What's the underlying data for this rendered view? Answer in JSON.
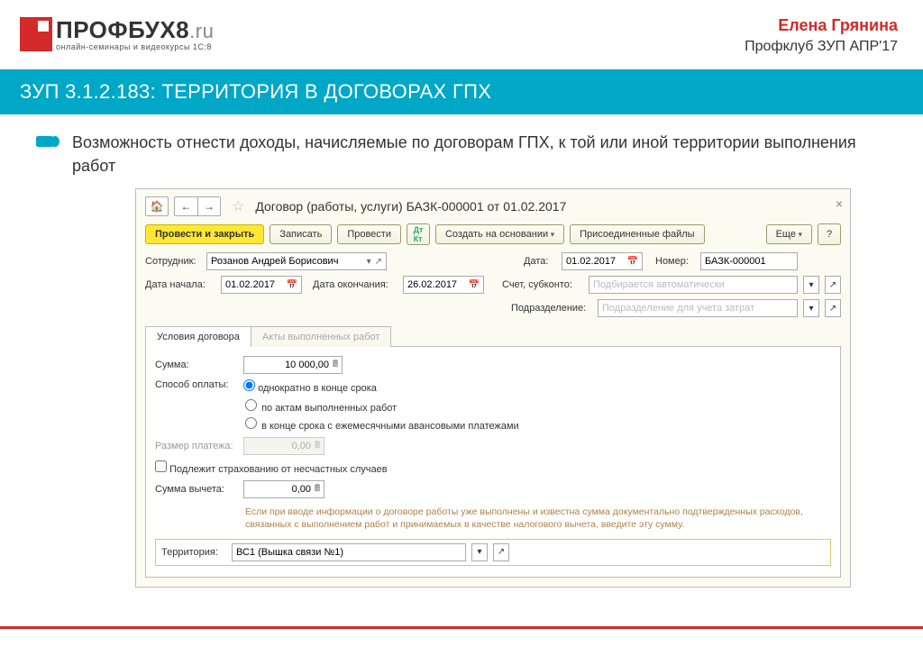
{
  "brand": {
    "main": "ПРОФБУХ8",
    "suffix": ".ru",
    "tagline": "онлайн-семинары и видеокурсы 1С:8"
  },
  "headerRight": {
    "name": "Елена Грянина",
    "sub": "Профклуб ЗУП АПР'17"
  },
  "slideTitle": "ЗУП 3.1.2.183: ТЕРРИТОРИЯ В ДОГОВОРАХ ГПХ",
  "bullet": "Возможность отнести доходы, начисляемые по договорам ГПХ, к той или иной территории выполнения работ",
  "win": {
    "title": "Договор (работы, услуги) БАЗК-000001 от 01.02.2017",
    "btn_primary": "Провести и закрыть",
    "btn_save": "Записать",
    "btn_post": "Провести",
    "btn_createBy": "Создать на основании",
    "btn_files": "Присоединенные файлы",
    "btn_more": "Еще",
    "lbl_employee": "Сотрудник:",
    "val_employee": "Розанов Андрей Борисович",
    "lbl_date": "Дата:",
    "val_date": "01.02.2017",
    "lbl_number": "Номер:",
    "val_number": "БАЗК-000001",
    "lbl_dateStart": "Дата начала:",
    "val_dateStart": "01.02.2017",
    "lbl_dateEnd": "Дата окончания:",
    "val_dateEnd": "26.02.2017",
    "lbl_account": "Счет, субконто:",
    "ph_account": "Подбирается автоматически",
    "lbl_dept": "Подразделение:",
    "ph_dept": "Подразделение для учета затрат",
    "tab1": "Условия договора",
    "tab2": "Акты выполненных работ",
    "lbl_sum": "Сумма:",
    "val_sum": "10 000,00",
    "lbl_payMethod": "Способ оплаты:",
    "opt1": "однократно в конце срока",
    "opt2": "по актам выполненных работ",
    "opt3": "в конце срока с ежемесячными авансовыми платежами",
    "lbl_paymentSize": "Размер платежа:",
    "val_paymentSize": "0,00",
    "chk_insurance": "Подлежит страхованию от несчастных случаев",
    "lbl_deduct": "Сумма вычета:",
    "val_deduct": "0,00",
    "hint": "Если при вводе информации о договоре работы уже выполнены и известна сумма документально подтвержденных расходов, связанных с выполнением работ и принимаемых в качестве налогового вычета, введите эту сумму.",
    "lbl_territory": "Территория:",
    "val_territory": "ВС1 (Вышка связи №1)"
  }
}
